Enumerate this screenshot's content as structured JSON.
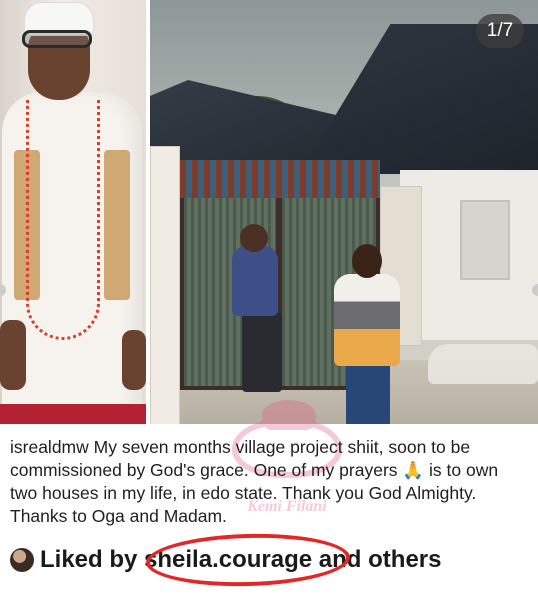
{
  "post": {
    "counter": "1/7",
    "username": "isrealdmw",
    "caption": " My seven months village project shiit, soon to be commissioned by God's grace. One of my prayers 🙏 is to own two houses in my life, in edo state. Thank you God Almighty. Thanks to Oga and Madam.",
    "watermark": "Kemi Filani",
    "liked": {
      "prefix": "Liked by ",
      "user": "sheila.courage",
      "middle": " and ",
      "others": "others"
    }
  },
  "colors": {
    "highlight_circle": "#e32626",
    "watermark": "#e0507a"
  },
  "icons": {
    "avatar": "avatar",
    "prayer": "folded-hands-emoji"
  }
}
